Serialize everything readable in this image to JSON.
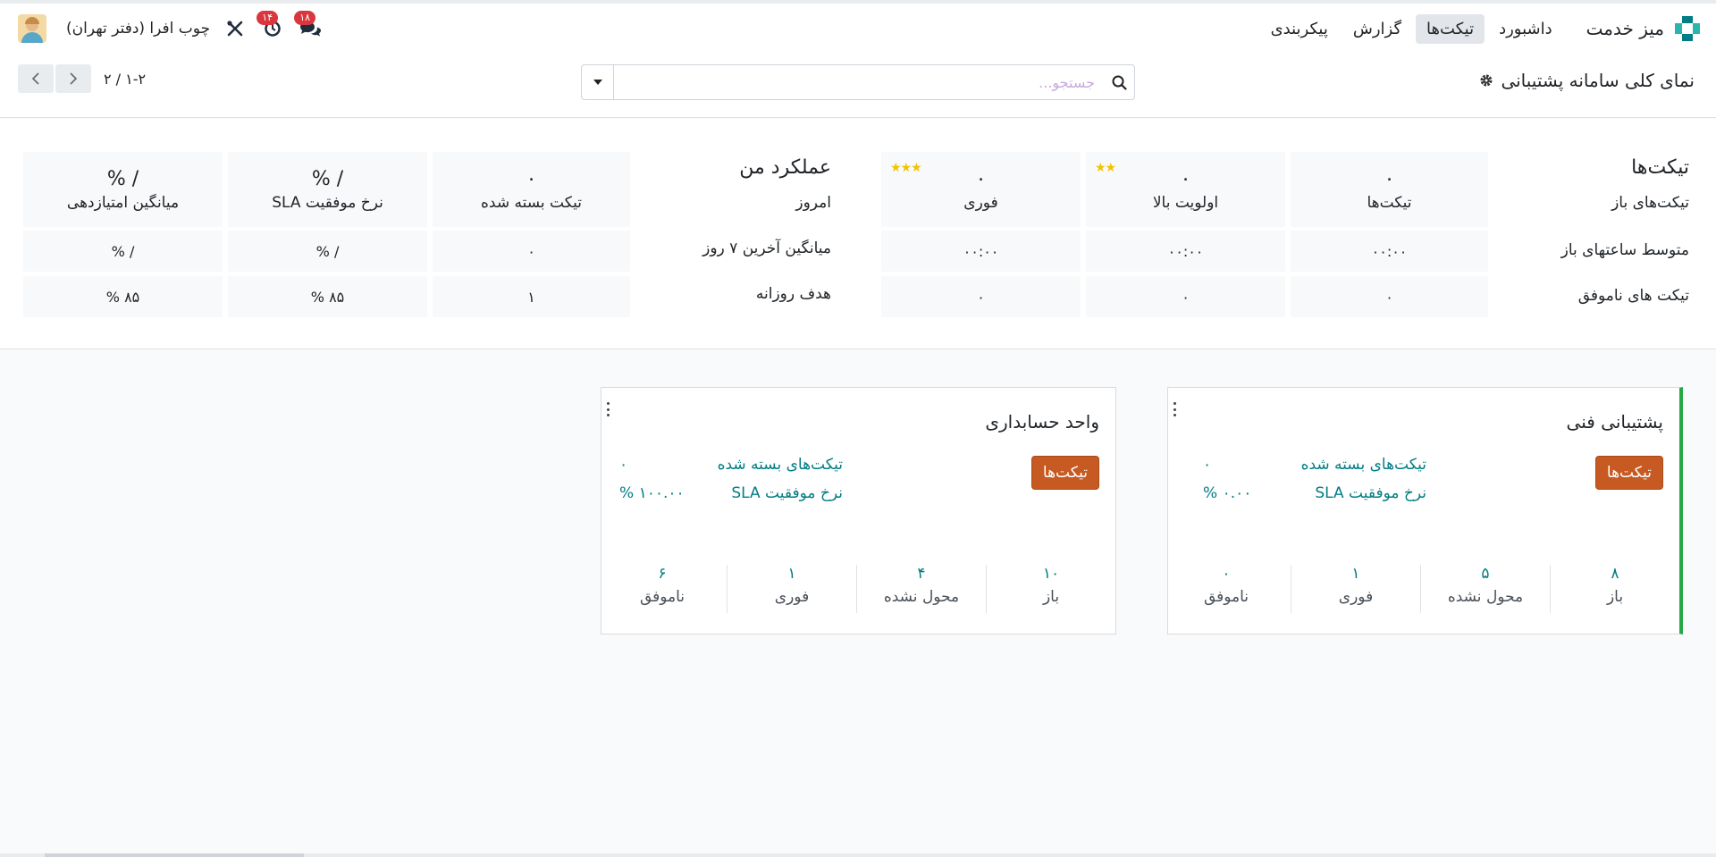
{
  "navbar": {
    "app_name": "میز خدمت",
    "menu": [
      {
        "label": "داشبورد",
        "active": false
      },
      {
        "label": "تیکت‌ها",
        "active": true
      },
      {
        "label": "گزارش",
        "active": false
      },
      {
        "label": "پیکربندی",
        "active": false
      }
    ],
    "messages_badge": "۱۸",
    "activities_badge": "۱۴",
    "company": "چوب افرا (دفتر تهران)",
    "accent_color": "#017e84"
  },
  "control": {
    "title": "نمای کلی سامانه پشتیبانی",
    "search_placeholder": "جستجو...",
    "pager_value": "۱-۲ / ۲"
  },
  "stats": {
    "tickets_title": "تیکت‌ها",
    "row_labels": [
      "تیکت‌های باز",
      "متوسط ساعتهای باز",
      "تیکت های ناموفق"
    ],
    "columns": [
      {
        "label": "تیکت‌ها",
        "count": "۰",
        "avg": "۰۰:۰۰",
        "failed": "۰",
        "stars": ""
      },
      {
        "label": "اولویت بالا",
        "count": "۰",
        "avg": "۰۰:۰۰",
        "failed": "۰",
        "stars": "★★"
      },
      {
        "label": "فوری",
        "count": "۰",
        "avg": "۰۰:۰۰",
        "failed": "۰",
        "stars": "★★★"
      }
    ],
    "perf_title": "عملکرد من",
    "perf_row_labels": [
      "امروز",
      "میانگین آخرین ۷ روز",
      "هدف روزانه"
    ],
    "perf_columns": [
      {
        "label": "تیکت بسته شده",
        "today": "۰",
        "avg7": "۰",
        "target": "۱"
      },
      {
        "label": "نرخ موفقیت SLA",
        "today": "/ %",
        "avg7": "/ %",
        "target": "۸۵ %"
      },
      {
        "label": "میانگین امتیازدهی",
        "today": "/ %",
        "avg7": "/ %",
        "target": "۸۵ %"
      }
    ]
  },
  "teams": [
    {
      "name": "پشتیبانی فنی",
      "button": "تیکت‌ها",
      "closed_label": "تیکت‌های بسته شده",
      "closed_value": "۰",
      "sla_label": "نرخ موفقیت SLA",
      "sla_value": "۰.۰۰ %",
      "stats": [
        {
          "value": "۸",
          "label": "باز"
        },
        {
          "value": "۵",
          "label": "محول نشده"
        },
        {
          "value": "۱",
          "label": "فوری"
        },
        {
          "value": "۰",
          "label": "ناموفق"
        }
      ]
    },
    {
      "name": "واحد حسابداری",
      "button": "تیکت‌ها",
      "closed_label": "تیکت‌های بسته شده",
      "closed_value": "۰",
      "sla_label": "نرخ موفقیت SLA",
      "sla_value": "۱۰۰.۰۰ %",
      "stats": [
        {
          "value": "۱۰",
          "label": "باز"
        },
        {
          "value": "۴",
          "label": "محول نشده"
        },
        {
          "value": "۱",
          "label": "فوری"
        },
        {
          "value": "۶",
          "label": "ناموفق"
        }
      ]
    }
  ]
}
